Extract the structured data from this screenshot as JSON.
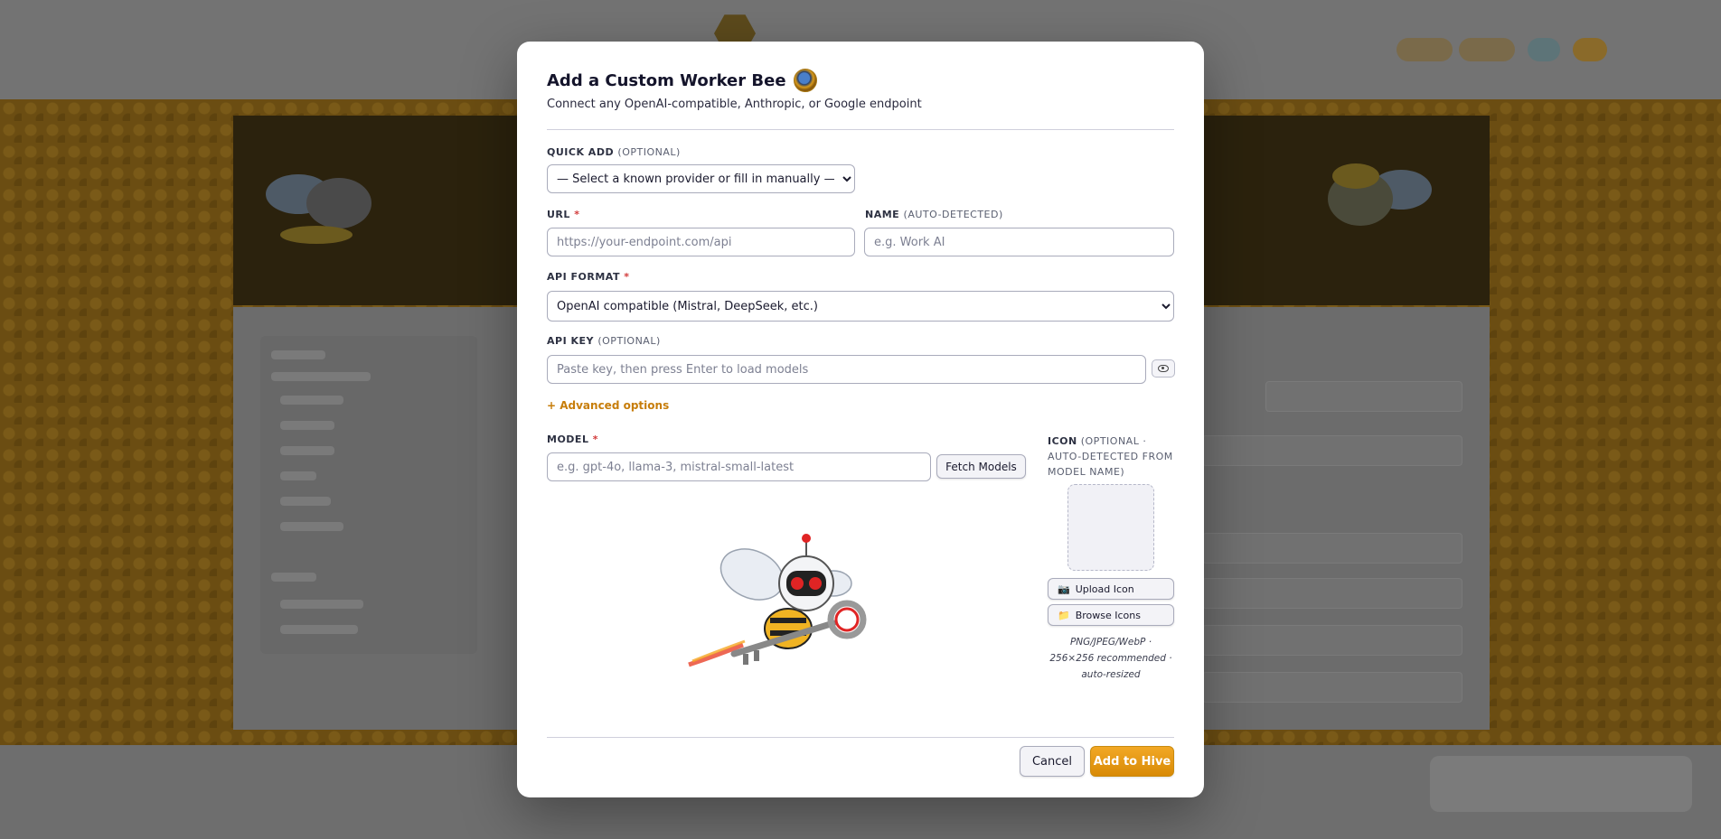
{
  "modal": {
    "title": "Add a Custom Worker Bee",
    "subtitle": "Connect any OpenAI-compatible, Anthropic, or Google endpoint",
    "quick_add": {
      "label": "QUICK ADD",
      "optional": "(OPTIONAL)",
      "selected": "— Select a known provider or fill in manually —"
    },
    "url": {
      "label": "URL",
      "required": "*",
      "placeholder": "https://your-endpoint.com/api"
    },
    "name": {
      "label": "NAME",
      "optional": "(AUTO-DETECTED)",
      "placeholder": "e.g. Work AI"
    },
    "api_format": {
      "label": "API FORMAT",
      "required": "*",
      "selected": "OpenAI compatible (Mistral, DeepSeek, etc.)"
    },
    "api_key": {
      "label": "API KEY",
      "optional": "(OPTIONAL)",
      "placeholder": "Paste key, then press Enter to load models"
    },
    "advanced_link": "+ Advanced options",
    "model": {
      "label": "MODEL",
      "required": "*",
      "placeholder": "e.g. gpt-4o, llama-3, mistral-small-latest",
      "fetch_button": "Fetch Models"
    },
    "icon": {
      "label": "ICON",
      "optional": "(OPTIONAL · AUTO-DETECTED FROM MODEL NAME)",
      "upload_button": "Upload Icon",
      "upload_icon": "camera-icon",
      "browse_button": "Browse Icons",
      "browse_icon": "folder-icon",
      "note": "PNG/JPEG/WebP · 256×256 recommended · auto-resized"
    },
    "buttons": {
      "cancel": "Cancel",
      "add": "Add to Hive"
    },
    "colors": {
      "accent": "#E89A12",
      "link": "#C77D0A",
      "required": "#D23A3A"
    }
  }
}
